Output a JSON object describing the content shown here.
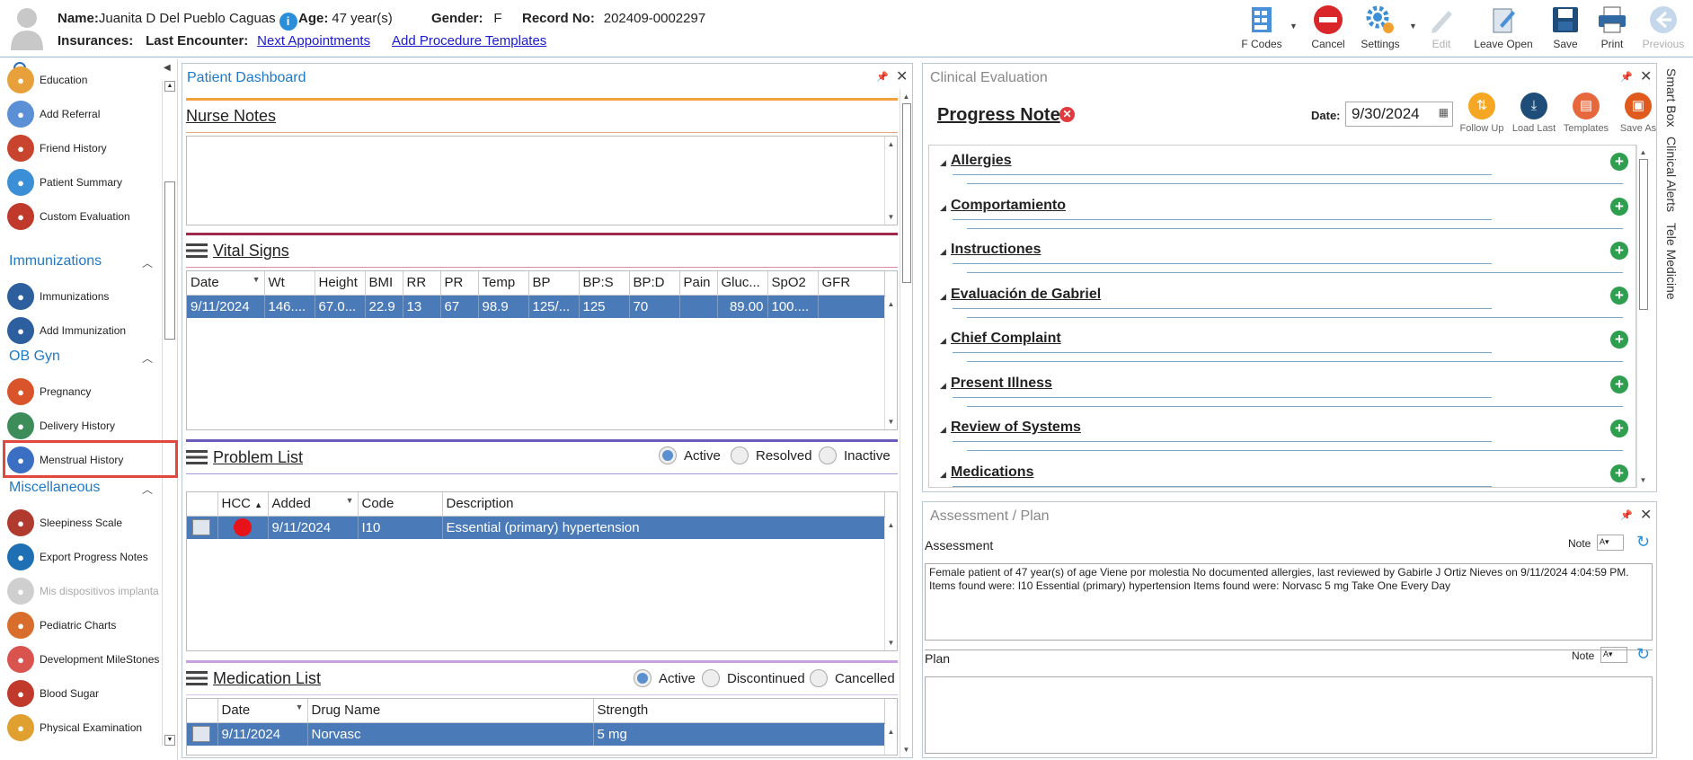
{
  "patient": {
    "name_label": "Name:",
    "name": "Juanita D Del Pueblo Caguas",
    "age_label": "Age:",
    "age": "47 year(s)",
    "gender_label": "Gender:",
    "gender": "F",
    "record_label": "Record No:",
    "record": "202409-0002297",
    "insurances_label": "Insurances:",
    "last_encounter_label": "Last Encounter:",
    "next_appointments": "Next Appointments",
    "add_procedure_templates": "Add Procedure Templates"
  },
  "toolbar": {
    "fcodes": "F Codes",
    "cancel": "Cancel",
    "settings": "Settings",
    "edit": "Edit",
    "leave_open": "Leave Open",
    "save": "Save",
    "print": "Print",
    "previous": "Previous"
  },
  "sidebar": {
    "items_top": [
      {
        "label": "Education",
        "color": "#e8a03a"
      },
      {
        "label": "Add Referral",
        "color": "#5b8fd6"
      },
      {
        "label": "Friend History",
        "color": "#c8442f"
      },
      {
        "label": "Patient Summary",
        "color": "#3a8fd6"
      },
      {
        "label": "Custom Evaluation",
        "color": "#c0392b"
      }
    ],
    "section_immunizations": "Immunizations",
    "items_imm": [
      {
        "label": "Immunizations",
        "color": "#2d5f9e"
      },
      {
        "label": "Add Immunization",
        "color": "#2d5f9e"
      }
    ],
    "section_obgyn": "OB Gyn",
    "items_ob": [
      {
        "label": "Pregnancy",
        "color": "#d9542b"
      },
      {
        "label": "Delivery History",
        "color": "#3c8d5a"
      },
      {
        "label": "Menstrual History",
        "color": "#3a6fc4"
      }
    ],
    "section_misc": "Miscellaneous",
    "items_misc": [
      {
        "label": "Sleepiness Scale",
        "color": "#b03a2e"
      },
      {
        "label": "Export Progress Notes",
        "color": "#1e6fb3"
      },
      {
        "label": "Mis dispositivos implanta",
        "color": "#cfcfcf"
      },
      {
        "label": "Pediatric Charts",
        "color": "#d86d2c"
      },
      {
        "label": "Development MileStones",
        "color": "#d9534f"
      },
      {
        "label": "Blood Sugar",
        "color": "#c0392b"
      },
      {
        "label": "Physical Examination",
        "color": "#e0a030"
      }
    ]
  },
  "dashboard": {
    "title": "Patient Dashboard",
    "nurse_notes": "Nurse Notes",
    "vital_signs": {
      "title": "Vital Signs",
      "columns": [
        "Date",
        "Wt",
        "Height",
        "BMI",
        "RR",
        "PR",
        "Temp",
        "BP",
        "BP:S",
        "BP:D",
        "Pain",
        "Gluc...",
        "SpO2",
        "GFR"
      ],
      "rows": [
        [
          "9/11/2024",
          "146....",
          "67.0...",
          "22.9",
          "13",
          "67",
          "98.9",
          "125/...",
          "125",
          "70",
          "",
          "89.00",
          "100....",
          ""
        ]
      ]
    },
    "problem_list": {
      "title": "Problem List",
      "filters": [
        "Active",
        "Resolved",
        "Inactive"
      ],
      "columns": [
        "HCC",
        "Added",
        "Code",
        "Description"
      ],
      "rows": [
        {
          "added": "9/11/2024",
          "code": "I10",
          "description": "Essential (primary) hypertension"
        }
      ]
    },
    "medication_list": {
      "title": "Medication List",
      "filters": [
        "Active",
        "Discontinued",
        "Cancelled"
      ],
      "columns": [
        "Date",
        "Drug Name",
        "Strength"
      ],
      "rows": [
        {
          "date": "9/11/2024",
          "drug": "Norvasc",
          "strength": "5 mg"
        }
      ]
    }
  },
  "clinical": {
    "title": "Clinical Evaluation",
    "note_title": "Progress Note",
    "date_label": "Date:",
    "date": "9/30/2024",
    "actions": [
      "Follow Up",
      "Load Last",
      "Templates",
      "Save As"
    ],
    "sections": [
      "Allergies",
      "Comportamiento",
      "Instructiones",
      "Evaluación de Gabriel",
      "Chief Complaint",
      "Present Illness",
      "Review of Systems",
      "Medications"
    ]
  },
  "assessment": {
    "title": "Assessment / Plan",
    "assessment_label": "Assessment",
    "note_label": "Note",
    "plan_label": "Plan",
    "text": "Female patient of 47 year(s) of age Viene por molestia     No documented allergies, last reviewed by Gabirle J Ortiz Nieves on 9/11/2024 4:04:59 PM.     Items found were:  I10 Essential (primary) hypertension  Items found were:  Norvasc 5 mg Take One Every Day"
  },
  "right_tabs": [
    "Smart Box",
    "Clinical Alerts",
    "Tele Medicine"
  ]
}
